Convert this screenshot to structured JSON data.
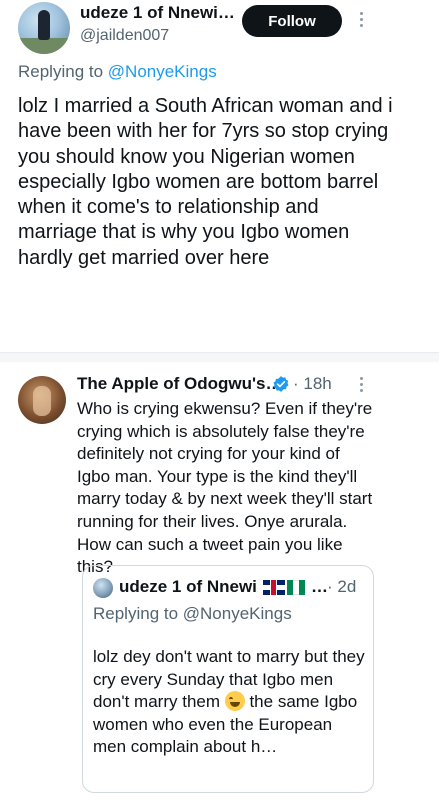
{
  "main_tweet": {
    "author_name": "udeze 1 of Nnewi…",
    "handle": "@jailden007",
    "follow_label": "Follow",
    "replying_prefix": "Replying to ",
    "replying_to": "@NonyeKings",
    "text": "lolz I married a South African woman and i have been with her for 7yrs so stop crying you should know you Nigerian women especially Igbo women are bottom barrel when it come's to relationship and marriage that is why you Igbo women hardly get married over here"
  },
  "reply_tweet": {
    "author_name": "The Apple of Odogwu's…",
    "time": "· 18h",
    "text": "Who is crying ekwensu? Even if they're crying which is absolutely false they're definitely not crying for your kind of Igbo man. Your type is the kind they'll marry today & by next week they'll start running for their lives. Onye arurala. How can such a tweet pain you like this?"
  },
  "quoted_tweet": {
    "author_name": "udeze 1 of Nnewi",
    "ellipsis": "…",
    "time": "· 2d",
    "replying_text": "Replying to @NonyeKings",
    "text_before_emoji": "lolz dey don't want to marry but they cry every Sunday that Igbo men don't marry them ",
    "text_after_emoji": " the same Igbo women who even the European men complain about h…"
  },
  "icons": {
    "verified": "verified-badge-icon",
    "more": "more-options-icon",
    "flags": [
      "uk-flag-icon",
      "nigeria-flag-icon"
    ],
    "emoji": "tears-of-joy-emoji"
  },
  "colors": {
    "accent": "#1d9bf0",
    "secondary_text": "#536471",
    "primary_text": "#0f1419"
  }
}
